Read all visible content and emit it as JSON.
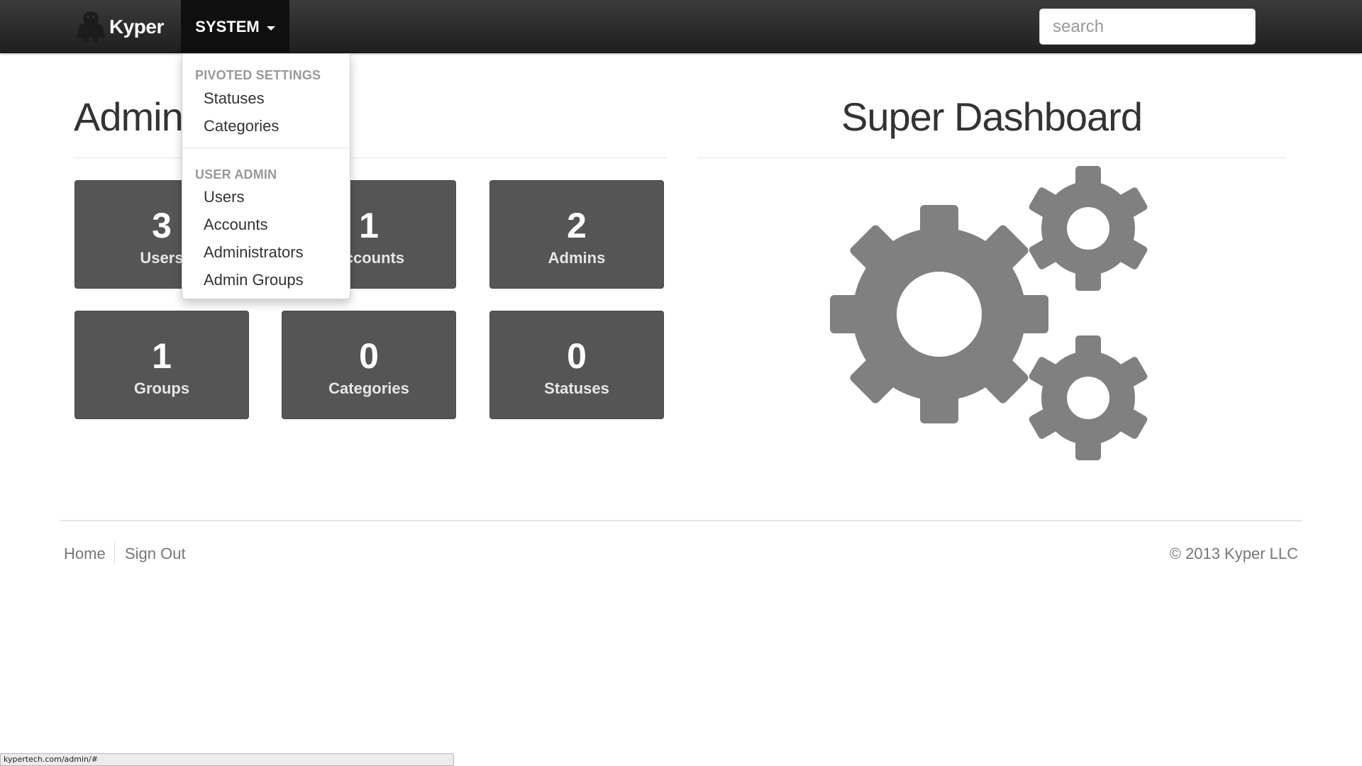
{
  "navbar": {
    "brand": "Kyper",
    "logo_icon": "kyper-logo-icon",
    "system_menu_label": "SYSTEM",
    "search": {
      "placeholder": "search",
      "value": ""
    }
  },
  "dropdown": {
    "sections": [
      {
        "header": "PIVOTED SETTINGS",
        "items": [
          "Statuses",
          "Categories"
        ]
      },
      {
        "header": "USER ADMIN",
        "items": [
          "Users",
          "Accounts",
          "Administrators",
          "Admin Groups"
        ]
      }
    ]
  },
  "admin": {
    "title": "Admin",
    "tiles": [
      {
        "count": "3",
        "label": "Users"
      },
      {
        "count": "1",
        "label": "Accounts"
      },
      {
        "count": "2",
        "label": "Admins"
      },
      {
        "count": "1",
        "label": "Groups"
      },
      {
        "count": "0",
        "label": "Categories"
      },
      {
        "count": "0",
        "label": "Statuses"
      }
    ]
  },
  "dashboard": {
    "title": "Super Dashboard",
    "illustration_icon": "gears-icon"
  },
  "footer": {
    "links": [
      "Home",
      "Sign Out"
    ],
    "copyright": "© 2013 Kyper LLC"
  },
  "status_bar": {
    "url": "kypertech.com/admin/#"
  },
  "colors": {
    "navbar_bg": "#2a2a2a",
    "system_tab_bg": "#0f0f0f",
    "tile_bg": "#555555",
    "gear_fill": "#808080",
    "dropdown_header": "#999999"
  }
}
